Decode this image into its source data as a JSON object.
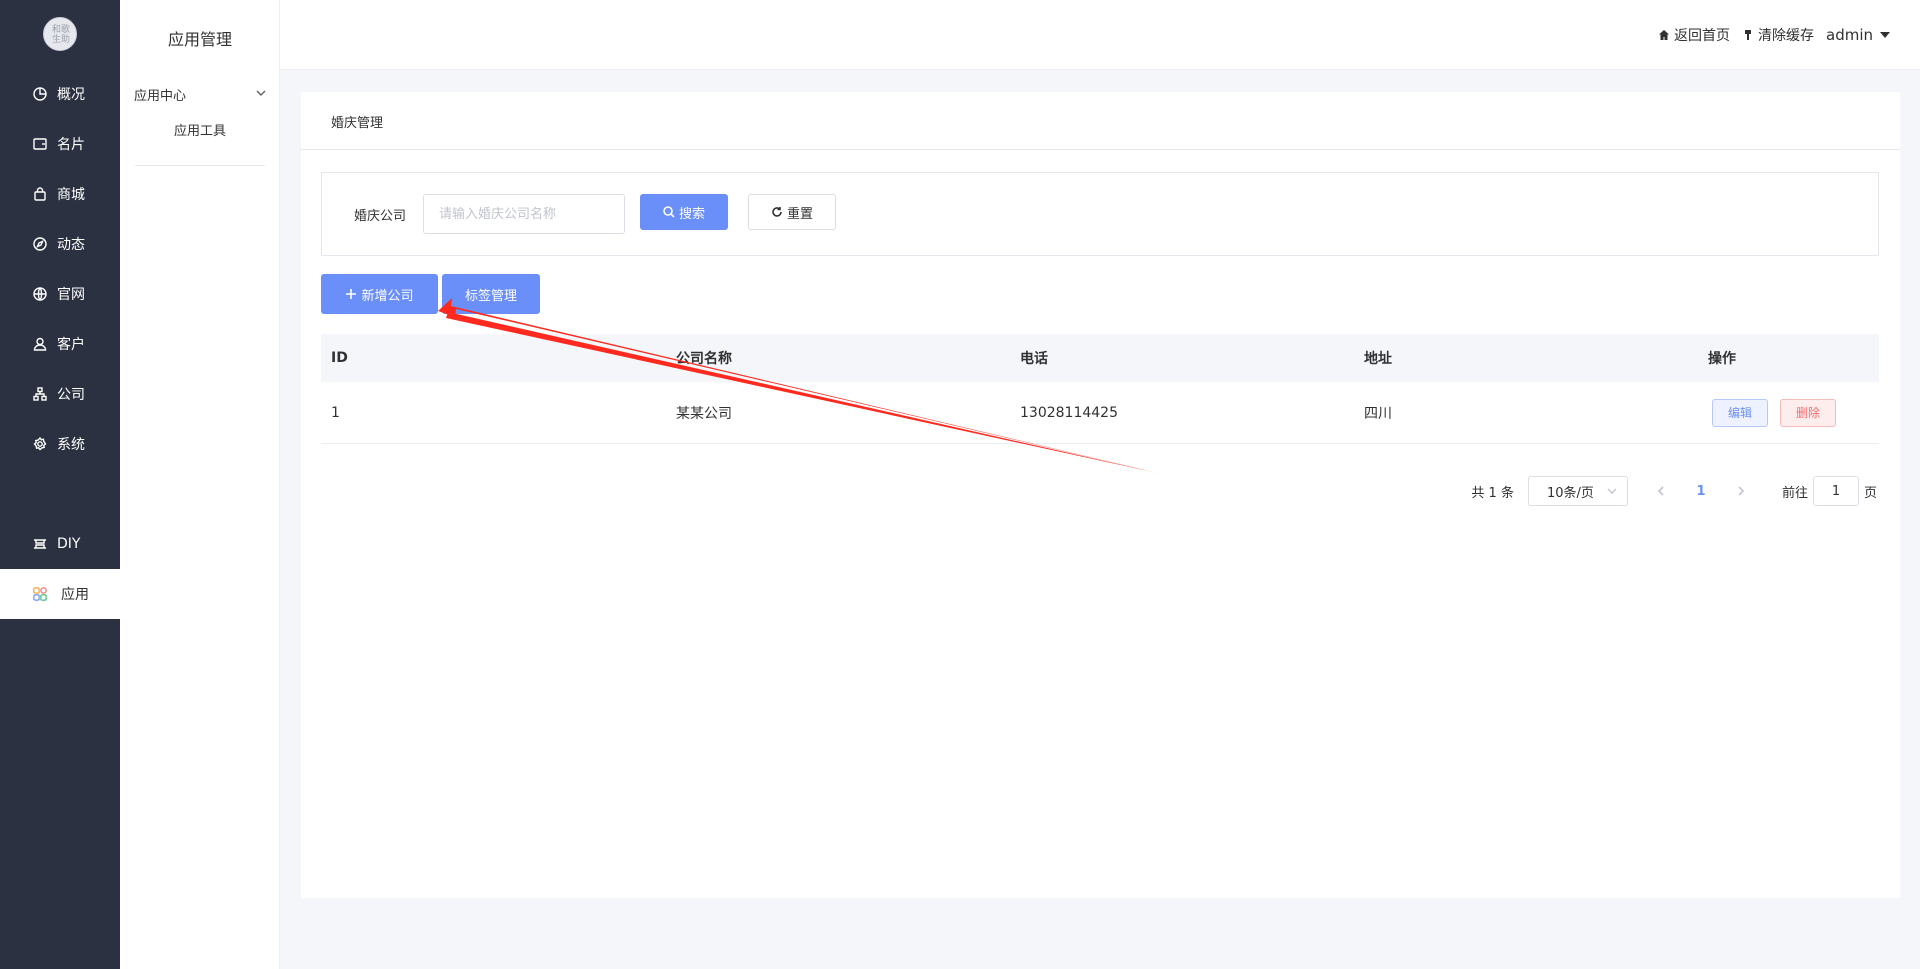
{
  "rail": {
    "logo_text": "和歌\n生助",
    "items": [
      {
        "label": "概况",
        "icon": "pie-chart-icon"
      },
      {
        "label": "名片",
        "icon": "wallet-icon"
      },
      {
        "label": "商城",
        "icon": "shopping-bag-icon"
      },
      {
        "label": "动态",
        "icon": "compass-icon"
      },
      {
        "label": "官网",
        "icon": "globe-icon"
      },
      {
        "label": "客户",
        "icon": "user-icon"
      },
      {
        "label": "公司",
        "icon": "org-chart-icon"
      },
      {
        "label": "系统",
        "icon": "gear-icon"
      },
      {
        "label": "DIY",
        "icon": "diy-icon"
      },
      {
        "label": "应用",
        "icon": "apps-icon",
        "active": true
      }
    ]
  },
  "subnav": {
    "title": "应用管理",
    "group_label": "应用中心",
    "sub_item": "应用工具"
  },
  "header": {
    "home_label": "返回首页",
    "clear_cache_label": "清除缓存",
    "user": "admin"
  },
  "page": {
    "breadcrumb": "婚庆管理",
    "filter": {
      "label": "婚庆公司",
      "placeholder": "请输入婚庆公司名称",
      "value": "",
      "search_label": "搜索",
      "reset_label": "重置"
    },
    "actions": {
      "add_label": "新增公司",
      "tags_label": "标签管理"
    },
    "table": {
      "columns": [
        "ID",
        "公司名称",
        "电话",
        "地址",
        "操作"
      ],
      "rows": [
        {
          "id": "1",
          "name": "某某公司",
          "phone": "13028114425",
          "address": "四川",
          "edit": "编辑",
          "delete": "删除"
        }
      ]
    },
    "pagination": {
      "total_text": "共 1 条",
      "page_size": "10条/页",
      "current_page": "1",
      "goto_label": "前往",
      "goto_value": "1",
      "page_suffix": "页"
    }
  },
  "colors": {
    "rail_bg": "#2b3140",
    "primary": "#6b8ff8",
    "danger": "#f56c6c",
    "annotation_arrow": "#ff2a1f"
  }
}
